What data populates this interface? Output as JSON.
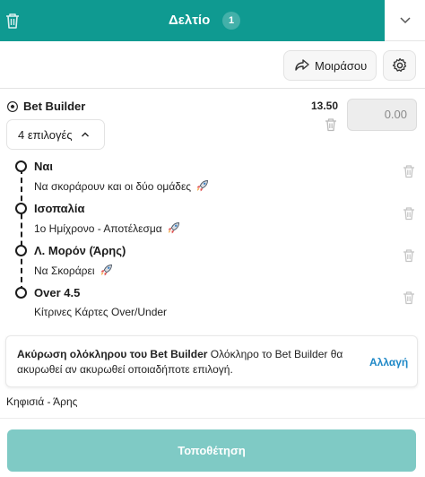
{
  "header": {
    "title": "Δελτίο",
    "count": "1",
    "colors": {
      "header_bg": "#0f9a91",
      "button_disabled": "#7fcac5",
      "link": "#1e88c7"
    }
  },
  "icons": {
    "clear": "trash-icon",
    "collapse": "chevron-down-icon",
    "share": "share-icon",
    "settings": "gear-icon",
    "sport": "soccer-ball-icon",
    "boost": "rocket-icon"
  },
  "toolbar": {
    "share_label": "Μοιράσου"
  },
  "bet": {
    "type_label": "Bet Builder",
    "odds": "13.50",
    "stake_placeholder": "0.00",
    "selections_toggle": "4 επιλογές"
  },
  "legs": [
    {
      "name": "Ναι",
      "market": "Να σκοράρουν και οι δύο ομάδες",
      "rocket": true
    },
    {
      "name": "Ισοπαλία",
      "market": "1ο Ημίχρονο - Αποτέλεσμα",
      "rocket": true
    },
    {
      "name": "Λ. Μορόν (Άρης)",
      "market": "Να Σκοράρει",
      "rocket": true
    },
    {
      "name": "Over 4.5",
      "market": "Κίτρινες Κάρτες Over/Under",
      "rocket": false
    }
  ],
  "notice": {
    "bold": "Ακύρωση ολόκληρου του Bet Builder",
    "text": " Ολόκληρο το Bet Builder θα ακυρωθεί αν ακυρωθεί οποιαδήποτε επιλογή.",
    "action": "Αλλαγή"
  },
  "match": "Κηφισιά - Άρης",
  "place_button": "Τοποθέτηση"
}
